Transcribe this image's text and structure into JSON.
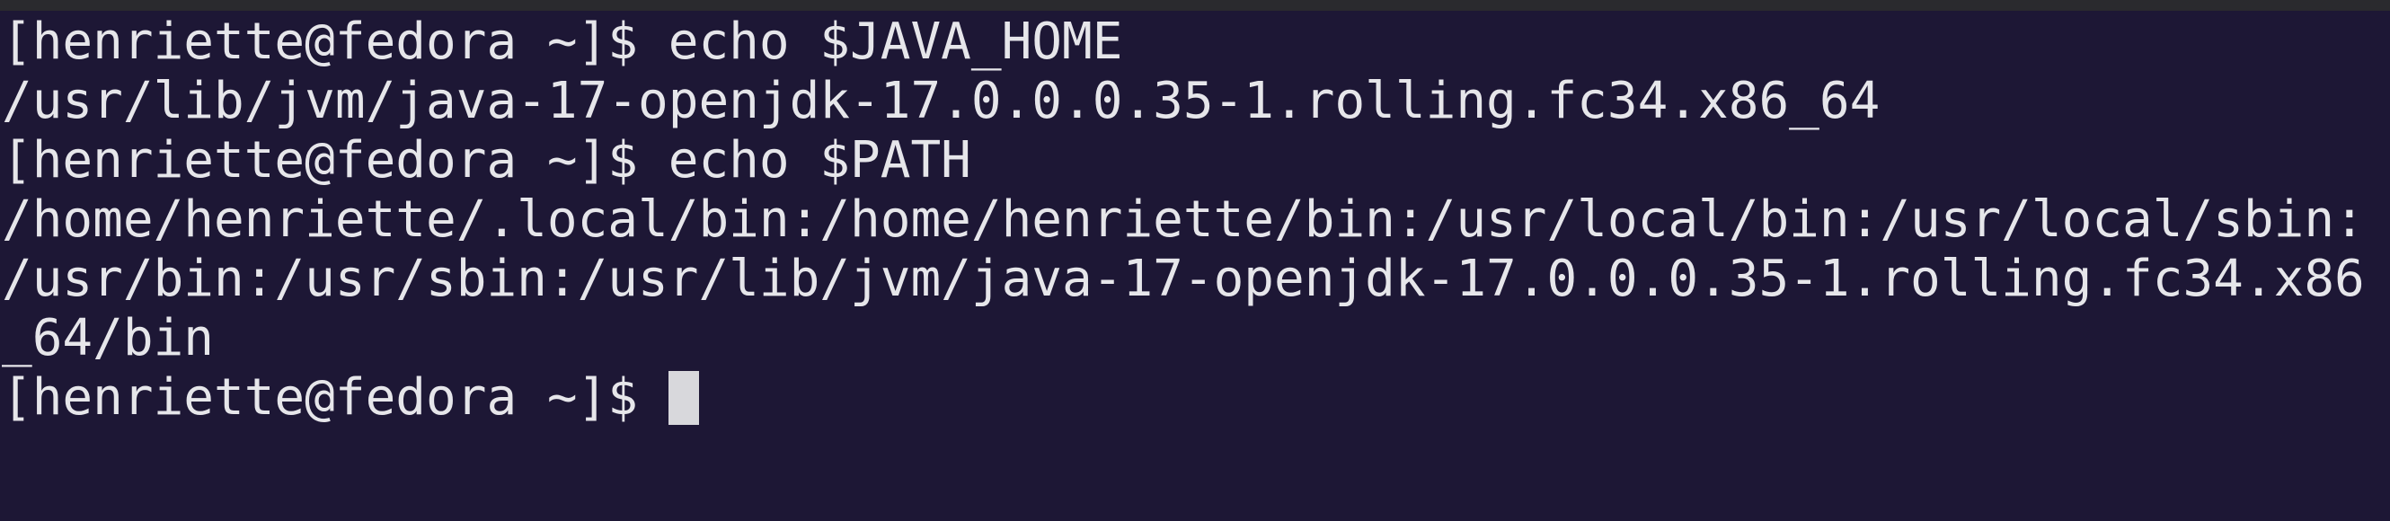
{
  "terminal": {
    "lines": [
      "[henriette@fedora ~]$ echo $JAVA_HOME",
      "/usr/lib/jvm/java-17-openjdk-17.0.0.0.35-1.rolling.fc34.x86_64",
      "[henriette@fedora ~]$ echo $PATH",
      "/home/henriette/.local/bin:/home/henriette/bin:/usr/local/bin:/usr/local/sbin:",
      "/usr/bin:/usr/sbin:/usr/lib/jvm/java-17-openjdk-17.0.0.0.35-1.rolling.fc34.x86",
      "_64/bin"
    ],
    "prompt": "[henriette@fedora ~]$ "
  },
  "colors": {
    "background": "#1d1735",
    "foreground": "#e6e6ea",
    "cursor": "#d8d8dc"
  }
}
